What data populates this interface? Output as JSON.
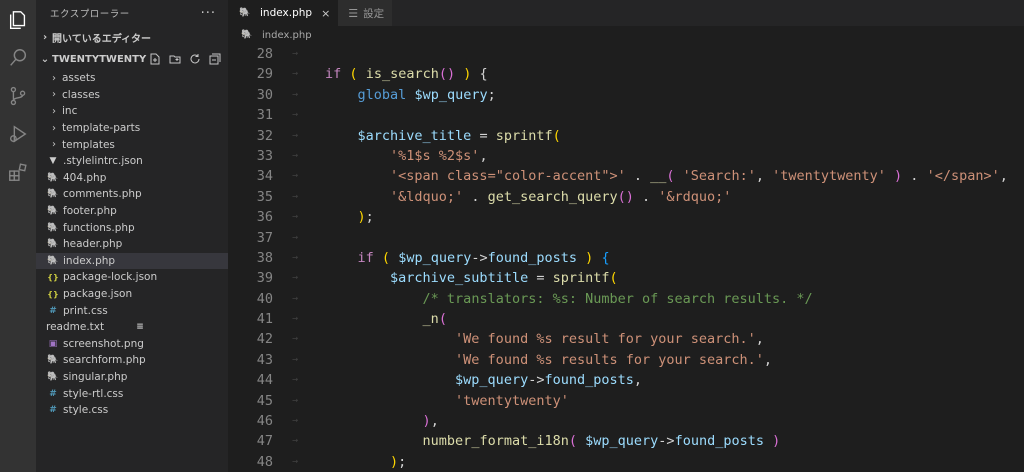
{
  "activity_bar": {
    "icons": [
      "explorer-icon",
      "search-icon",
      "source-control-icon",
      "run-debug-icon",
      "extensions-icon"
    ]
  },
  "sidebar": {
    "title": "エクスプローラー",
    "more": "···",
    "open_editors": "開いているエディター",
    "project": "TWENTYTWENTY",
    "folders": [
      "assets",
      "classes",
      "inc",
      "template-parts",
      "templates"
    ],
    "files": [
      {
        "name": ".stylelintrc.json",
        "type": "lint"
      },
      {
        "name": "404.php",
        "type": "php"
      },
      {
        "name": "comments.php",
        "type": "php"
      },
      {
        "name": "footer.php",
        "type": "php"
      },
      {
        "name": "functions.php",
        "type": "php"
      },
      {
        "name": "header.php",
        "type": "php"
      },
      {
        "name": "index.php",
        "type": "php",
        "selected": true
      },
      {
        "name": "package-lock.json",
        "type": "json"
      },
      {
        "name": "package.json",
        "type": "json"
      },
      {
        "name": "print.css",
        "type": "css"
      },
      {
        "name": "readme.txt",
        "type": "txt"
      },
      {
        "name": "screenshot.png",
        "type": "png"
      },
      {
        "name": "searchform.php",
        "type": "php"
      },
      {
        "name": "singular.php",
        "type": "php"
      },
      {
        "name": "style-rtl.css",
        "type": "css"
      },
      {
        "name": "style.css",
        "type": "css"
      }
    ]
  },
  "tabs": {
    "active": "index.php",
    "inactive": "設定"
  },
  "breadcrumb": "index.php",
  "code": {
    "line_numbers": [
      "28",
      "29",
      "30",
      "31",
      "32",
      "33",
      "34",
      "35",
      "36",
      "37",
      "38",
      "39",
      "40",
      "41",
      "42",
      "43",
      "44",
      "45",
      "46",
      "47",
      "48"
    ],
    "lines": [
      [],
      [
        [
          "k",
          "if"
        ],
        [
          "p",
          " "
        ],
        [
          "b1",
          "("
        ],
        [
          "p",
          " "
        ],
        [
          "f",
          "is_search"
        ],
        [
          "b2",
          "()"
        ],
        [
          "p",
          " "
        ],
        [
          "b1",
          ")"
        ],
        [
          "p",
          " {"
        ]
      ],
      [
        [
          "p",
          "    "
        ],
        [
          "g",
          "global"
        ],
        [
          "p",
          " "
        ],
        [
          "v",
          "$wp_query"
        ],
        [
          "p",
          ";"
        ]
      ],
      [],
      [
        [
          "p",
          "    "
        ],
        [
          "v",
          "$archive_title"
        ],
        [
          "p",
          " = "
        ],
        [
          "f",
          "sprintf"
        ],
        [
          "b1",
          "("
        ]
      ],
      [
        [
          "p",
          "        "
        ],
        [
          "s",
          "'%1$s %2$s'"
        ],
        [
          "p",
          ","
        ]
      ],
      [
        [
          "p",
          "        "
        ],
        [
          "s",
          "'<span class=\"color-accent\">'"
        ],
        [
          "p",
          " . "
        ],
        [
          "f",
          "__"
        ],
        [
          "b2",
          "("
        ],
        [
          "p",
          " "
        ],
        [
          "s",
          "'Search:'"
        ],
        [
          "p",
          ", "
        ],
        [
          "s",
          "'twentytwenty'"
        ],
        [
          "p",
          " "
        ],
        [
          "b2",
          ")"
        ],
        [
          "p",
          " . "
        ],
        [
          "s",
          "'</span>'"
        ],
        [
          "p",
          ","
        ]
      ],
      [
        [
          "p",
          "        "
        ],
        [
          "s",
          "'&ldquo;'"
        ],
        [
          "p",
          " . "
        ],
        [
          "f",
          "get_search_query"
        ],
        [
          "b2",
          "()"
        ],
        [
          "p",
          " . "
        ],
        [
          "s",
          "'&rdquo;'"
        ]
      ],
      [
        [
          "p",
          "    "
        ],
        [
          "b1",
          ")"
        ],
        [
          "p",
          ";"
        ]
      ],
      [],
      [
        [
          "p",
          "    "
        ],
        [
          "k",
          "if"
        ],
        [
          "p",
          " "
        ],
        [
          "b1",
          "("
        ],
        [
          "p",
          " "
        ],
        [
          "v",
          "$wp_query"
        ],
        [
          "p",
          "->"
        ],
        [
          "v",
          "found_posts"
        ],
        [
          "p",
          " "
        ],
        [
          "b1",
          ")"
        ],
        [
          "p",
          " "
        ],
        [
          "b3",
          "{"
        ]
      ],
      [
        [
          "p",
          "        "
        ],
        [
          "v",
          "$archive_subtitle"
        ],
        [
          "p",
          " = "
        ],
        [
          "f",
          "sprintf"
        ],
        [
          "b1",
          "("
        ]
      ],
      [
        [
          "p",
          "            "
        ],
        [
          "c",
          "/* translators: %s: Number of search results. */"
        ]
      ],
      [
        [
          "p",
          "            "
        ],
        [
          "f",
          "_n"
        ],
        [
          "b2",
          "("
        ]
      ],
      [
        [
          "p",
          "                "
        ],
        [
          "s",
          "'We found %s result for your search.'"
        ],
        [
          "p",
          ","
        ]
      ],
      [
        [
          "p",
          "                "
        ],
        [
          "s",
          "'We found %s results for your search.'"
        ],
        [
          "p",
          ","
        ]
      ],
      [
        [
          "p",
          "                "
        ],
        [
          "v",
          "$wp_query"
        ],
        [
          "p",
          "->"
        ],
        [
          "v",
          "found_posts"
        ],
        [
          "p",
          ","
        ]
      ],
      [
        [
          "p",
          "                "
        ],
        [
          "s",
          "'twentytwenty'"
        ]
      ],
      [
        [
          "p",
          "            "
        ],
        [
          "b2",
          ")"
        ],
        [
          "p",
          ","
        ]
      ],
      [
        [
          "p",
          "            "
        ],
        [
          "f",
          "number_format_i18n"
        ],
        [
          "b2",
          "("
        ],
        [
          "p",
          " "
        ],
        [
          "v",
          "$wp_query"
        ],
        [
          "p",
          "->"
        ],
        [
          "v",
          "found_posts"
        ],
        [
          "p",
          " "
        ],
        [
          "b2",
          ")"
        ]
      ],
      [
        [
          "p",
          "        "
        ],
        [
          "b1",
          ")"
        ],
        [
          "p",
          ";"
        ]
      ]
    ]
  }
}
